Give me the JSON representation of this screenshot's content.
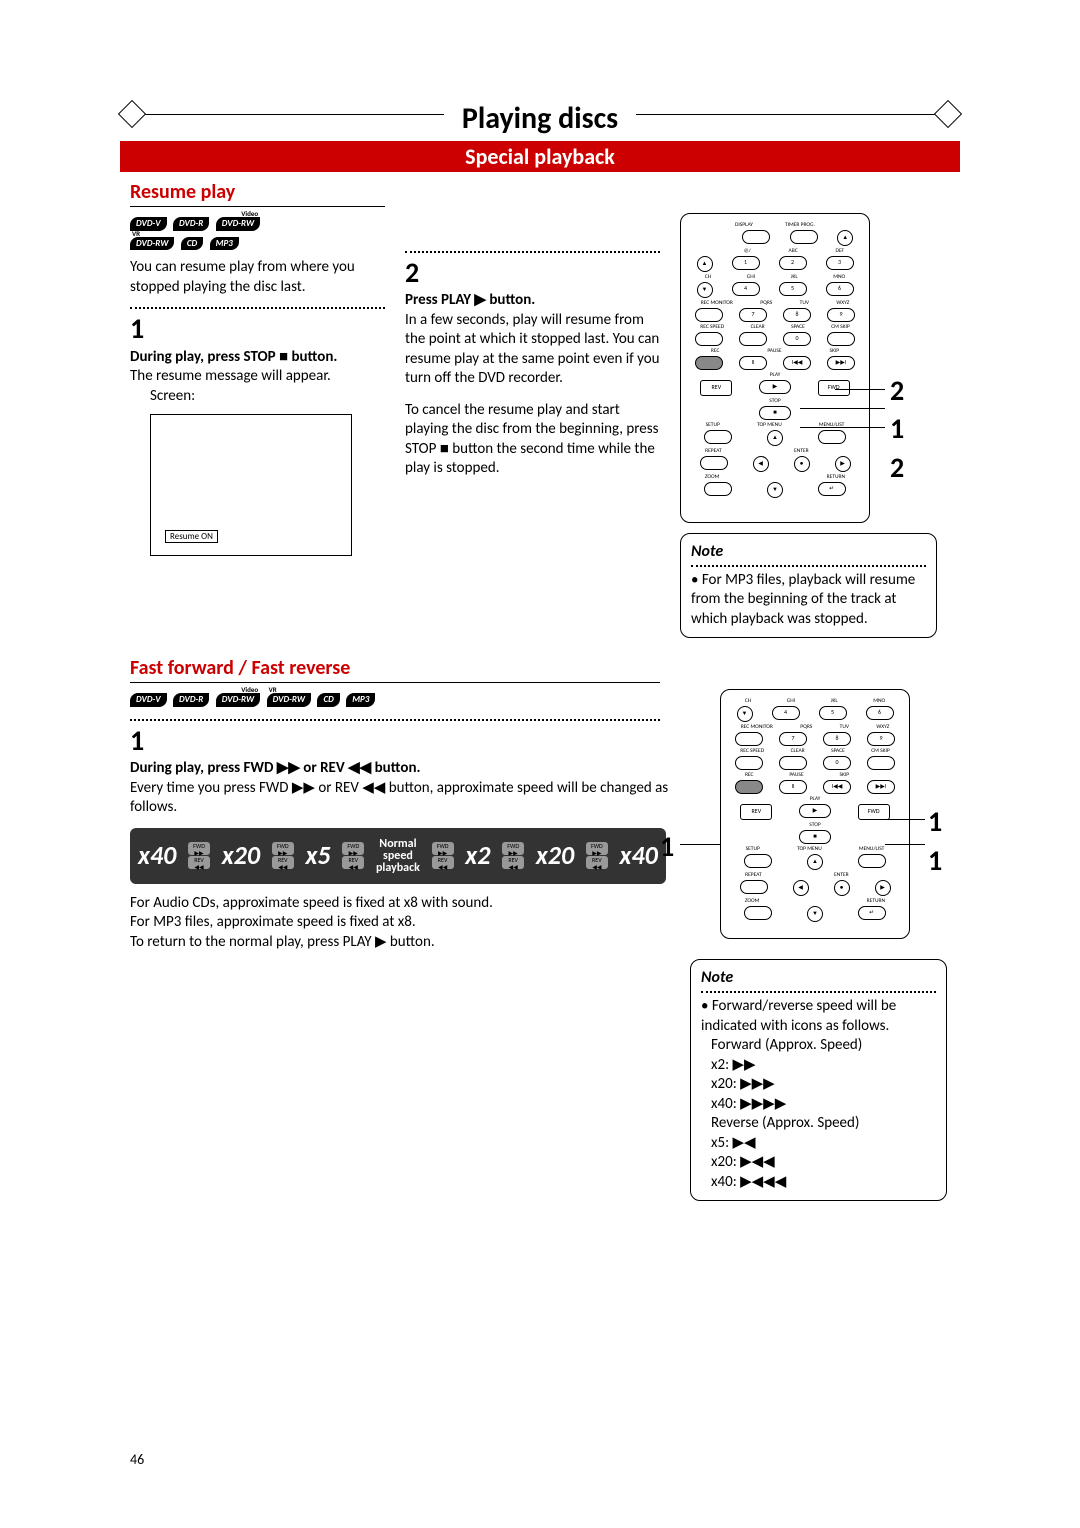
{
  "page": {
    "number": "46",
    "title": "Playing discs",
    "subtitle": "Special playback"
  },
  "section1": {
    "heading": "Resume play",
    "disc_types": [
      "DVD-V",
      "DVD-R",
      "DVD-RW",
      "DVD-RW",
      "CD",
      "MP3"
    ],
    "disc_sup": {
      "2": "Video",
      "3": "VR"
    },
    "intro": "You can resume play from where you stopped playing the disc last.",
    "step1": {
      "num": "1",
      "heading": "During play, press STOP ■ button.",
      "body": "The resume message will appear.",
      "screen_label": "Screen:",
      "resume_on": "Resume ON"
    },
    "step2": {
      "num": "2",
      "heading": "Press PLAY ▶ button.",
      "body1": "In a few seconds, play will resume from the point at which it stopped last. You can resume play at the same point even if you turn off the DVD recorder.",
      "body2": "To cancel the resume play and start playing the disc from the beginning, press STOP ■ button the second time while the play is stopped."
    },
    "note": {
      "label": "Note",
      "body": "For MP3 files, playback will resume from the beginning of the track at which playback was stopped."
    },
    "callouts": [
      "2",
      "1",
      "2"
    ]
  },
  "section2": {
    "heading": "Fast forward / Fast reverse",
    "disc_types": [
      "DVD-V",
      "DVD-R",
      "DVD-RW",
      "DVD-RW",
      "CD",
      "MP3"
    ],
    "disc_sup": {
      "2": "Video",
      "3": "VR"
    },
    "step1": {
      "num": "1",
      "heading": "During play, press FWD ▶▶ or REV ◀◀ button.",
      "body": "Every time you press FWD ▶▶ or REV ◀◀ button, approximate speed will be changed as follows."
    },
    "speeds": {
      "rev": [
        "x40",
        "x20",
        "x5"
      ],
      "mid_top": "Normal",
      "mid_mid": "speed",
      "mid_bot": "playback",
      "fwd": [
        "x2",
        "x20",
        "x40"
      ],
      "btn_fwd": "FWD",
      "btn_rev": "REV"
    },
    "after": [
      "For Audio CDs, approximate speed is fixed at x8 with sound.",
      "For MP3 files, approximate speed is fixed at x8.",
      "To return to the normal play, press PLAY ▶ button."
    ],
    "note": {
      "label": "Note",
      "bullet1": "Forward/reverse speed will be indicated with icons as follows.",
      "fwd_label": "Forward (Approx. Speed)",
      "fwd": [
        "x2:   ▶▶",
        "x20: ▶▶▶",
        "x40: ▶▶▶▶"
      ],
      "rev_label": "Reverse (Approx. Speed)",
      "rev": [
        "x5:   ▶◀",
        "x20: ▶◀◀",
        "x40: ▶◀◀◀"
      ]
    },
    "callouts_left": [
      "1"
    ],
    "callouts_right": [
      "1",
      "1"
    ]
  },
  "remote": {
    "row1": [
      "DISPLAY",
      "TIMER PROG."
    ],
    "row2_lbl": [
      "@/",
      "ABC",
      "DEF"
    ],
    "row3_lbl": [
      "CH",
      "GHI",
      "JKL",
      "MNO"
    ],
    "row4_lbl": [
      "REC MONITOR",
      "PQRS",
      "TUV",
      "WXYZ"
    ],
    "row5_lbl": [
      "REC SPEED",
      "CLEAR",
      "SPACE",
      "CM SKIP"
    ],
    "rec": "REC",
    "pause": "PAUSE",
    "skip": "SKIP",
    "rev": "REV",
    "play": "PLAY",
    "fwd": "FWD",
    "stop": "STOP",
    "setup": "SETUP",
    "topmenu": "TOP MENU",
    "menulist": "MENU/LIST",
    "repeat": "REPEAT",
    "enter": "ENTER",
    "return": "RETURN",
    "zoom": "ZOOM"
  }
}
